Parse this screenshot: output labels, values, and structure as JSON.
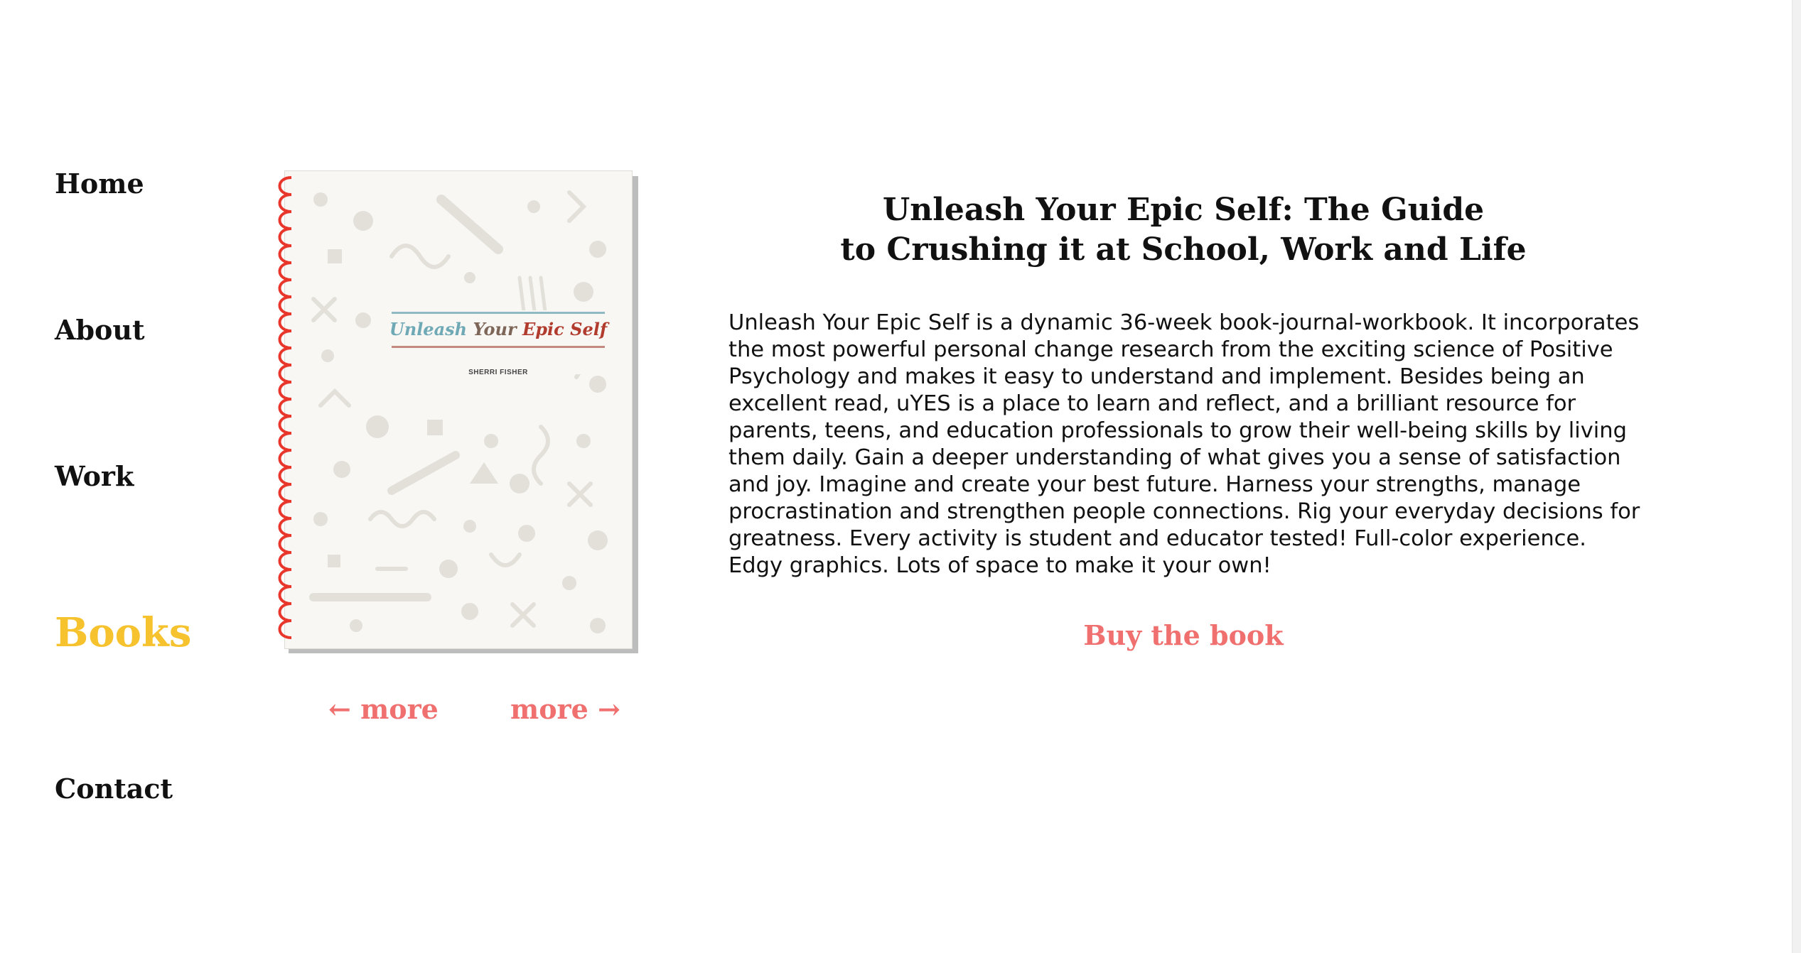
{
  "nav": {
    "items": [
      {
        "label": "Home"
      },
      {
        "label": "About"
      },
      {
        "label": "Work"
      },
      {
        "label": "Books"
      },
      {
        "label": "Contact"
      }
    ],
    "active_index": 3
  },
  "book": {
    "cover_title_part1": "Unleash ",
    "cover_title_part2": "Your ",
    "cover_title_part3": "Epic Self",
    "cover_author": "SHERRI FISHER"
  },
  "pager": {
    "prev_label": "← more",
    "next_label": "more →"
  },
  "content": {
    "title_line1": "Unleash Your Epic Self: The Guide",
    "title_line2": "to Crushing it at School, Work and Life",
    "description": "Unleash Your Epic Self is a dynamic 36-week book-journal-workbook. It incorporates the most powerful personal change research from the exciting science of Positive Psychology and makes it easy to understand and implement. Besides being an excellent read, uYES is a place to learn and reflect, and a brilliant resource for parents, teens, and education professionals to grow their well-being skills by living them daily. Gain a deeper understanding of what gives you a sense of satisfaction and joy. Imagine and create your best future. Harness your strengths, manage procrastination and strengthen people connections. Rig your everyday decisions for greatness. Every activity is student and educator tested! Full-color experience. Edgy graphics. Lots of space to make it your own!",
    "buy_label": "Buy the book"
  },
  "colors": {
    "active_nav": "#f6c22d",
    "link": "#f07070",
    "text": "#111111",
    "spiral": "#e8362b"
  }
}
